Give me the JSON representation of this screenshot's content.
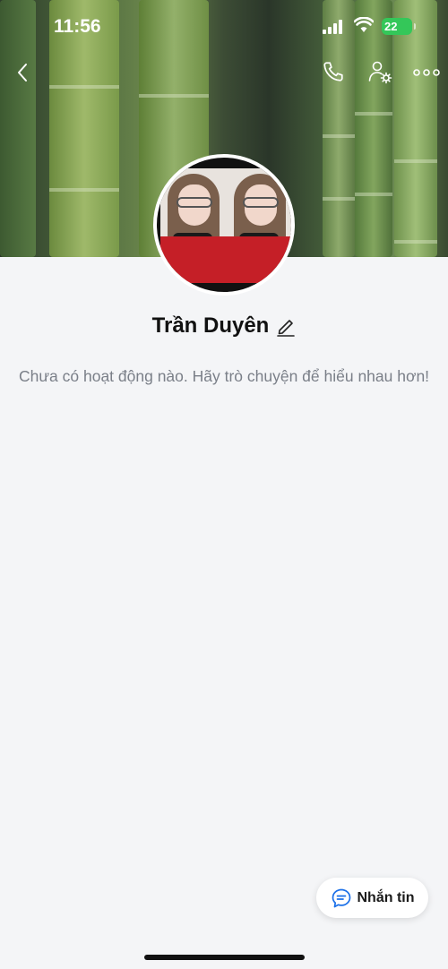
{
  "status_bar": {
    "time": "11:56",
    "battery": "22"
  },
  "profile": {
    "name": "Trần Duyên",
    "subtitle": "Chưa có hoạt động nào. Hãy trò chuyện để hiểu nhau hơn!"
  },
  "actions": {
    "message_label": "Nhắn tin"
  },
  "icons": {
    "back": "chevron-left-icon",
    "call": "phone-icon",
    "settings": "user-settings-icon",
    "more": "more-icon",
    "edit": "pencil-icon",
    "message": "chat-bubble-icon"
  },
  "colors": {
    "accent": "#1a6fe8",
    "battery": "#34c759",
    "background": "#f4f5f7"
  }
}
